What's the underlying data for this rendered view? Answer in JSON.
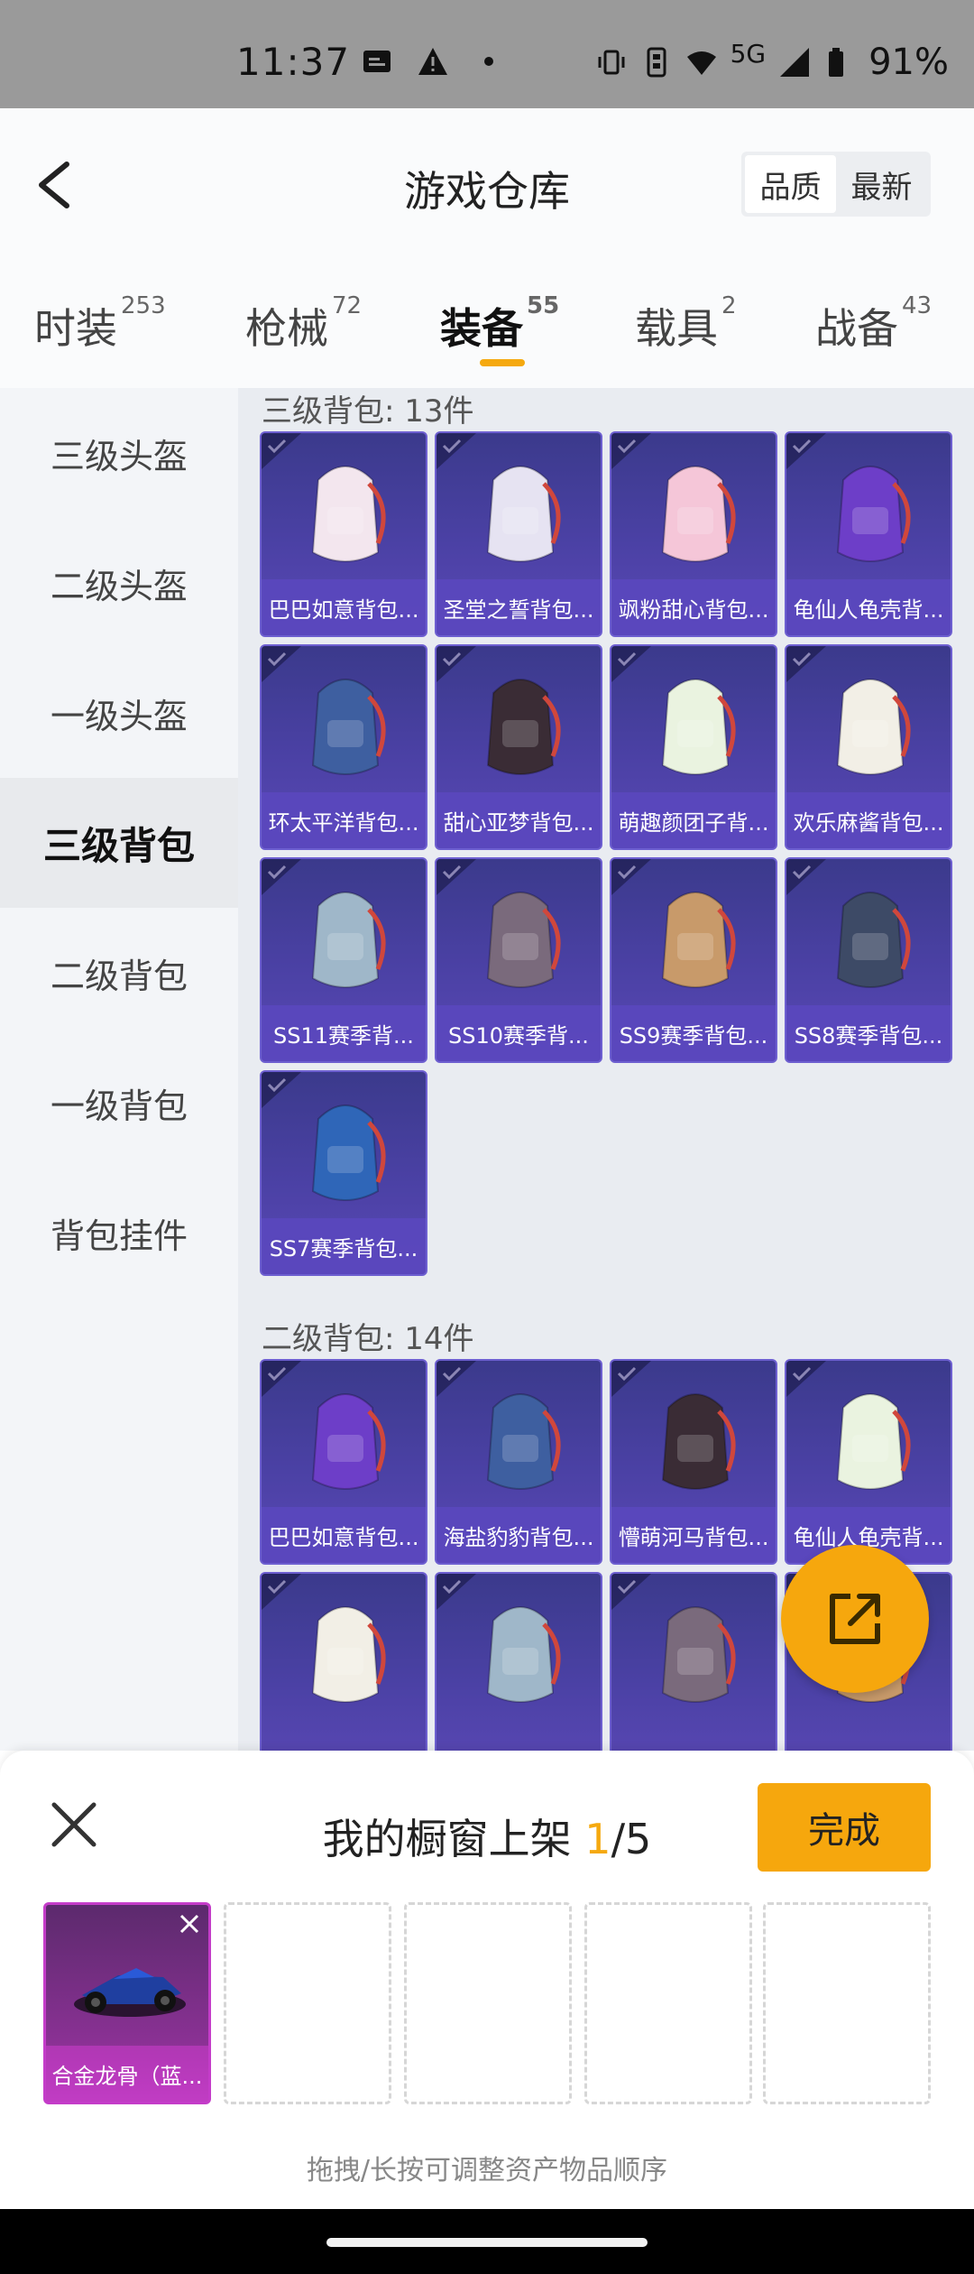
{
  "status_bar": {
    "time": "11:37",
    "network": "5G",
    "battery": "91%",
    "icons_left": [
      "message-icon",
      "warning-icon",
      "dot-icon"
    ],
    "icons_right": [
      "vibrate-icon",
      "sim-icon",
      "wifi-icon",
      "signal-icon",
      "battery-icon"
    ]
  },
  "header": {
    "title": "游戏仓库",
    "sort_options": [
      "品质",
      "最新"
    ],
    "sort_active": "品质"
  },
  "tabs": [
    {
      "label": "时装",
      "count": "253"
    },
    {
      "label": "枪械",
      "count": "72"
    },
    {
      "label": "装备",
      "count": "55",
      "active": true
    },
    {
      "label": "载具",
      "count": "2"
    },
    {
      "label": "战备",
      "count": "43"
    }
  ],
  "sidebar": {
    "items": [
      "三级头盔",
      "二级头盔",
      "一级头盔",
      "三级背包",
      "二级背包",
      "一级背包",
      "背包挂件"
    ],
    "active": "三级背包"
  },
  "sections": [
    {
      "title": "三级背包: 13件",
      "items": [
        "巴巴如意背包...",
        "圣堂之誓背包...",
        "飒粉甜心背包...",
        "龟仙人龟壳背...",
        "环太平洋背包...",
        "甜心亚梦背包...",
        "萌趣颜团子背...",
        "欢乐麻酱背包...",
        "SS11赛季背...",
        "SS10赛季背...",
        "SS9赛季背包...",
        "SS8赛季背包...",
        "SS7赛季背包..."
      ]
    },
    {
      "title": "二级背包: 14件",
      "items": [
        "巴巴如意背包...",
        "海盐豹豹背包...",
        "懵萌河马背包...",
        "龟仙人龟壳背...",
        "",
        "",
        "",
        ""
      ]
    }
  ],
  "bottom_sheet": {
    "title_prefix": "我的橱窗上架 ",
    "count_current": "1",
    "count_total": "/5",
    "done_label": "完成",
    "slots": [
      {
        "label": "合金龙骨（蓝...",
        "filled": true
      },
      {
        "filled": false
      },
      {
        "filled": false
      },
      {
        "filled": false
      },
      {
        "filled": false
      }
    ],
    "hint": "拖拽/长按可调整资产物品顺序"
  },
  "colors": {
    "accent": "#f6a70d",
    "card_purple": "#4b41a5",
    "card_label": "#5a48be",
    "vehicle_slot": "#8a3194"
  }
}
